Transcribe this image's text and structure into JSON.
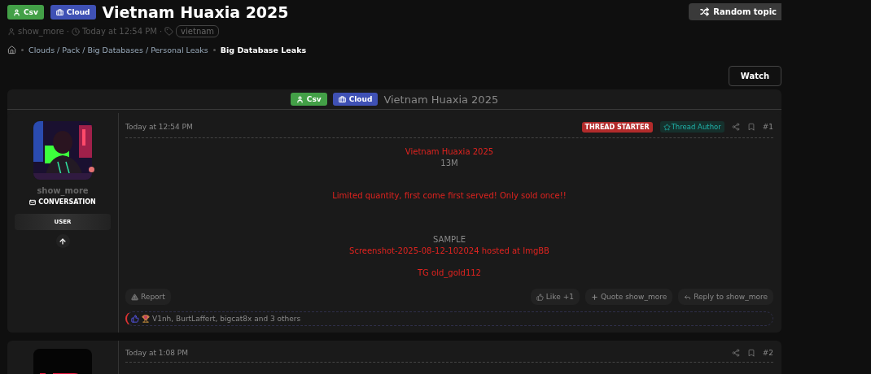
{
  "header": {
    "prefixes": [
      {
        "label": "Csv",
        "color": "#43a047",
        "kind": "user"
      },
      {
        "label": "Cloud",
        "color": "#3f51b5",
        "kind": "briefcase"
      }
    ],
    "title": "Vietnam Huaxia 2025",
    "author": "show_more",
    "separator": "·",
    "date": "Today at 12:54 PM",
    "tags": [
      "vietnam"
    ]
  },
  "random_button": "Random topic",
  "breadcrumbs": [
    "Clouds / Pack / Big Databases / Personal Leaks"
  ],
  "breadcrumb_current": "Big Database Leaks",
  "watch_button": "Watch",
  "thread_header": {
    "prefixes": [
      {
        "label": "Csv",
        "color": "#43a047",
        "kind": "user"
      },
      {
        "label": "Cloud",
        "color": "#3f51b5",
        "kind": "briefcase"
      }
    ],
    "title": "Vietnam Huaxia 2025"
  },
  "posts": [
    {
      "author": {
        "name": "show_more",
        "online": true,
        "link": "CONVERSATION",
        "role": "USER"
      },
      "date": "Today at 12:54 PM",
      "starter_badge": "THREAD STARTER",
      "author_badge": "Thread Author",
      "number": "#1",
      "body": [
        {
          "kind": "accent",
          "text": "Vietnam Huaxia 2025"
        },
        {
          "kind": "plain",
          "text": "13M"
        },
        {
          "kind": "blank"
        },
        {
          "kind": "blank"
        },
        {
          "kind": "accent",
          "text": "Limited quantity, first come first served! Only sold once!!"
        },
        {
          "kind": "blank"
        },
        {
          "kind": "blank"
        },
        {
          "kind": "blank"
        },
        {
          "kind": "plain",
          "text": "SAMPLE"
        },
        {
          "kind": "accent",
          "text": "Screenshot-2025-08-12-102024 hosted at ImgBB"
        },
        {
          "kind": "blank"
        },
        {
          "kind": "accent",
          "text": "TG old_gold112"
        }
      ],
      "report": "Report",
      "actions": [
        {
          "kind": "like",
          "label": "Like +1"
        },
        {
          "kind": "quote",
          "label": "Quote show_more"
        },
        {
          "kind": "reply",
          "label": "Reply to show_more"
        }
      ],
      "reactions": "V1nh, BurtLaffert, bigcat8x and 3 others"
    },
    {
      "date": "Today at 1:08 PM",
      "number": "#2"
    }
  ]
}
